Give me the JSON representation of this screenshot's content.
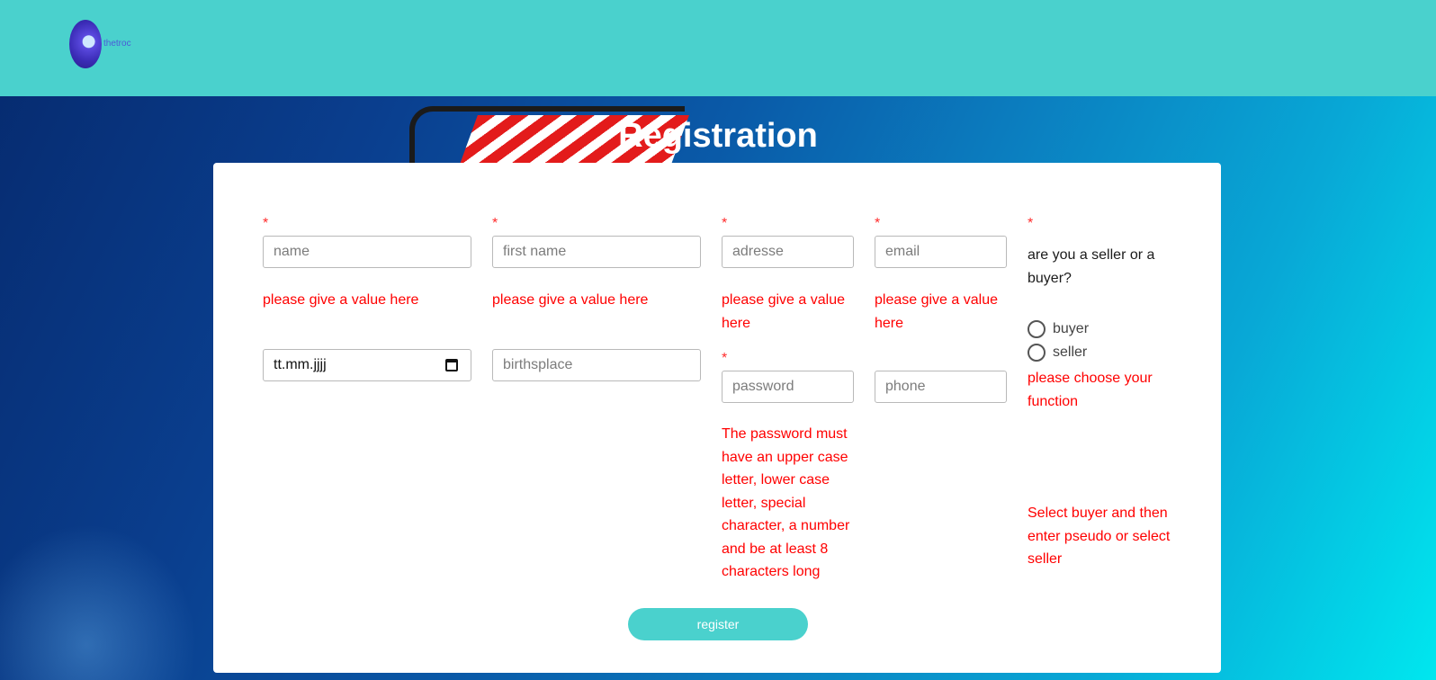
{
  "header": {
    "logo_text": "thetroc"
  },
  "page": {
    "title": "Registration"
  },
  "form": {
    "required_mark": "*",
    "name": {
      "placeholder": "name",
      "error": "please give a value here"
    },
    "first_name": {
      "placeholder": "first name",
      "error": "please give a value here"
    },
    "adresse": {
      "placeholder": "adresse",
      "error": "please give a value here"
    },
    "email": {
      "placeholder": "email",
      "error": "please give a value here"
    },
    "birthdate": {
      "placeholder": "tt.mm.jjjj"
    },
    "birthsplace": {
      "placeholder": "birthsplace"
    },
    "password": {
      "placeholder": "password",
      "error": "The password must have an upper case letter, lower case letter, special character, a number and be at least 8 characters long"
    },
    "phone": {
      "placeholder": "phone"
    },
    "role": {
      "question": "are you a seller or a buyer?",
      "options": [
        "buyer",
        "seller"
      ],
      "error": "please choose your function",
      "hint": "Select buyer and then enter pseudo or select seller"
    },
    "submit_label": "register"
  }
}
